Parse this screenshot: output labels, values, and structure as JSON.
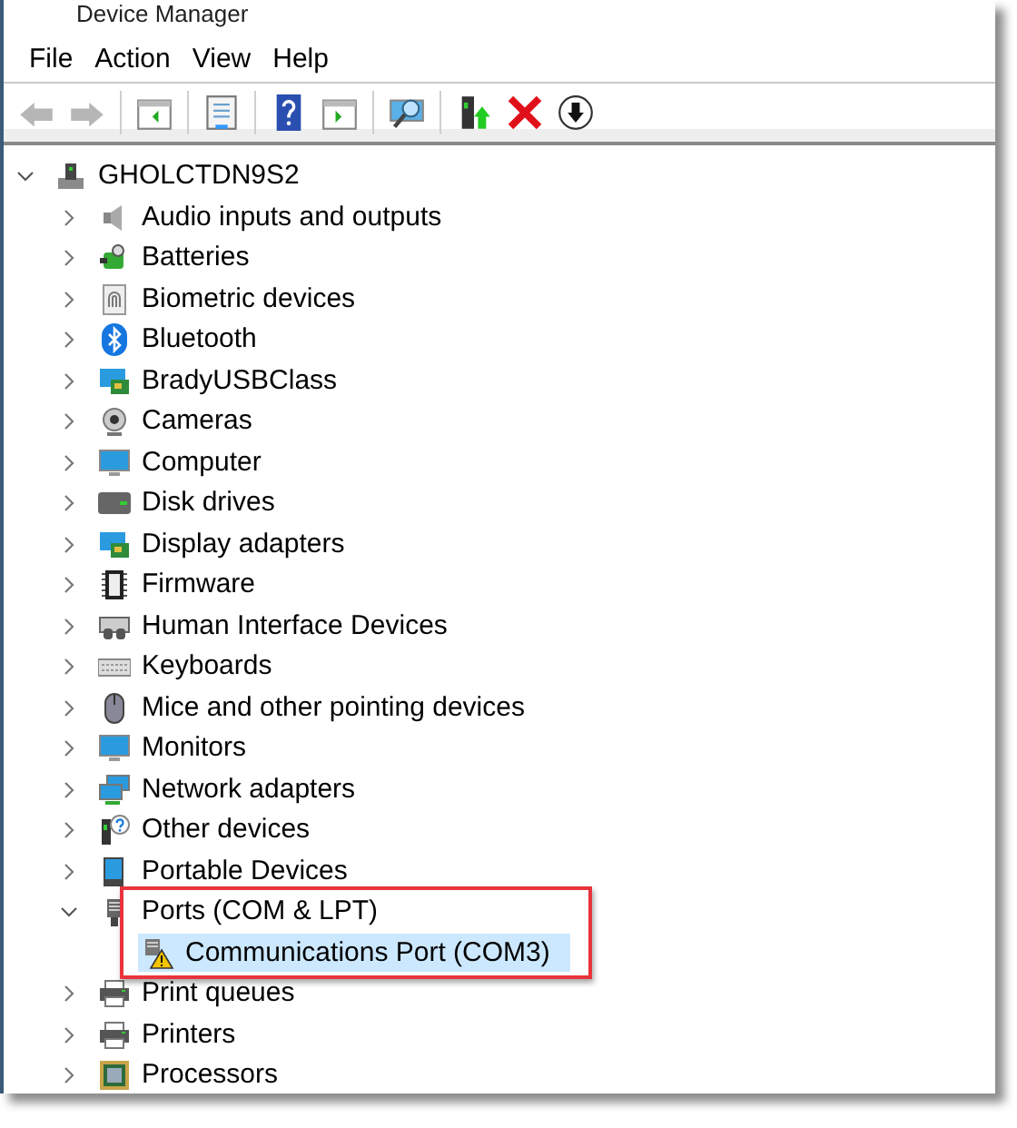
{
  "window": {
    "title": "Device Manager"
  },
  "menu": [
    "File",
    "Action",
    "View",
    "Help"
  ],
  "toolbar": [
    {
      "kind": "back",
      "disabled": true
    },
    {
      "kind": "forward",
      "disabled": true
    },
    {
      "kind": "separator"
    },
    {
      "kind": "tree-pane",
      "disabled": false
    },
    {
      "kind": "separator"
    },
    {
      "kind": "properties",
      "disabled": false
    },
    {
      "kind": "separator"
    },
    {
      "kind": "help",
      "disabled": false
    },
    {
      "kind": "action-pane",
      "disabled": false
    },
    {
      "kind": "separator"
    },
    {
      "kind": "scan",
      "disabled": false
    },
    {
      "kind": "separator"
    },
    {
      "kind": "update",
      "disabled": false
    },
    {
      "kind": "uninstall",
      "disabled": false
    },
    {
      "kind": "download",
      "disabled": false
    }
  ],
  "tree": {
    "label": "GHOLCTDN9S2",
    "kind": "computer-root",
    "expanded": true,
    "children": [
      {
        "label": "Audio inputs and outputs",
        "kind": "speaker",
        "expanded": false
      },
      {
        "label": "Batteries",
        "kind": "battery",
        "expanded": false
      },
      {
        "label": "Biometric devices",
        "kind": "fingerprint",
        "expanded": false
      },
      {
        "label": "Bluetooth",
        "kind": "bluetooth",
        "expanded": false
      },
      {
        "label": "BradyUSBClass",
        "kind": "board",
        "expanded": false
      },
      {
        "label": "Cameras",
        "kind": "webcam",
        "expanded": false
      },
      {
        "label": "Computer",
        "kind": "monitor",
        "expanded": false
      },
      {
        "label": "Disk drives",
        "kind": "disk",
        "expanded": false
      },
      {
        "label": "Display adapters",
        "kind": "board",
        "expanded": false
      },
      {
        "label": "Firmware",
        "kind": "chip",
        "expanded": false
      },
      {
        "label": "Human Interface Devices",
        "kind": "hid",
        "expanded": false
      },
      {
        "label": "Keyboards",
        "kind": "keyboard",
        "expanded": false
      },
      {
        "label": "Mice and other pointing devices",
        "kind": "mouse",
        "expanded": false
      },
      {
        "label": "Monitors",
        "kind": "monitor",
        "expanded": false
      },
      {
        "label": "Network adapters",
        "kind": "network",
        "expanded": false
      },
      {
        "label": "Other devices",
        "kind": "unknown",
        "expanded": false
      },
      {
        "label": "Portable Devices",
        "kind": "portable",
        "expanded": false
      },
      {
        "label": "Ports (COM & LPT)",
        "kind": "port",
        "expanded": true,
        "highlighted": true,
        "children": [
          {
            "label": "Communications Port (COM3)",
            "kind": "port-warning",
            "selected": true
          }
        ]
      },
      {
        "label": "Print queues",
        "kind": "printer",
        "expanded": false
      },
      {
        "label": "Printers",
        "kind": "printer",
        "expanded": false
      },
      {
        "label": "Processors",
        "kind": "processor",
        "expanded": false
      }
    ]
  }
}
